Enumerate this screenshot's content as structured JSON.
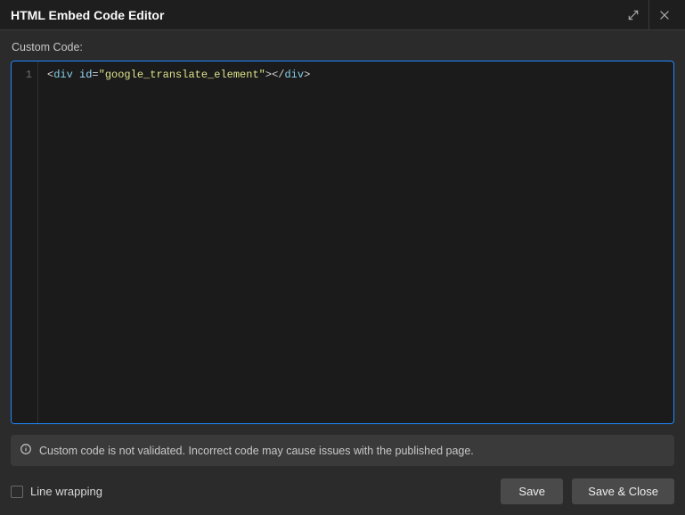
{
  "header": {
    "title": "HTML Embed Code Editor",
    "expand_icon": "expand-icon",
    "close_icon": "close-icon"
  },
  "editor": {
    "label": "Custom Code:",
    "line_number": "1",
    "code": {
      "open_angle": "<",
      "tag": "div",
      "space": " ",
      "attr": "id",
      "eq": "=",
      "quote_open": "\"",
      "value": "google_translate_element",
      "quote_close": "\"",
      "close_angle": ">",
      "open_angle2": "</",
      "tag2": "div",
      "close_angle2": ">"
    }
  },
  "notice": {
    "text": "Custom code is not validated. Incorrect code may cause issues with the published page."
  },
  "footer": {
    "linewrap_label": "Line wrapping",
    "save_label": "Save",
    "save_close_label": "Save & Close"
  }
}
